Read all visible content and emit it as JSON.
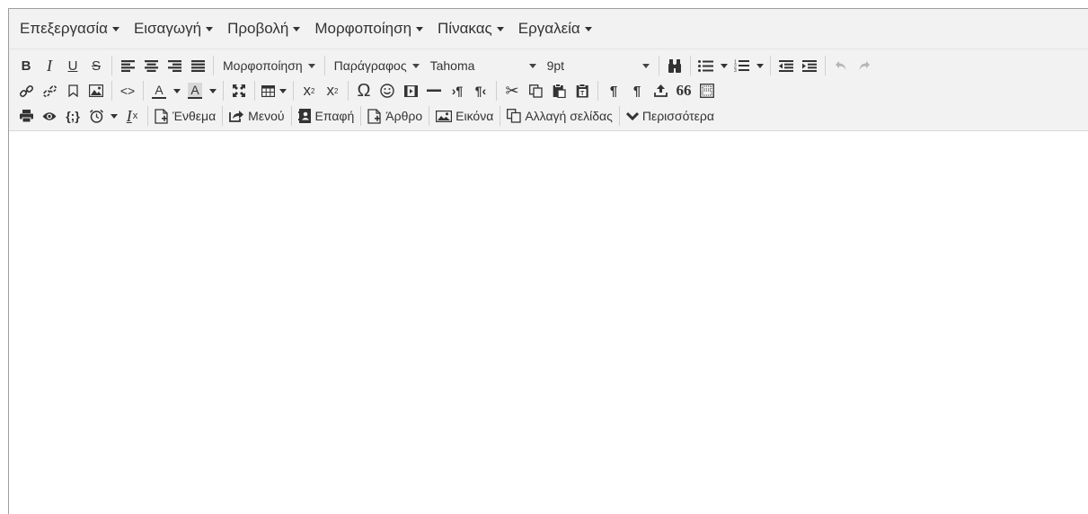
{
  "menubar": {
    "items": [
      {
        "label": "Επεξεργασία"
      },
      {
        "label": "Εισαγωγή"
      },
      {
        "label": "Προβολή"
      },
      {
        "label": "Μορφοποίηση"
      },
      {
        "label": "Πίνακας"
      },
      {
        "label": "Εργαλεία"
      }
    ]
  },
  "toolbar": {
    "bold": "B",
    "italic": "I",
    "underline": "U",
    "strikethrough": "S",
    "formats": "Μορφοποίηση",
    "paragraph": "Παράγραφος",
    "font_family": "Tahoma",
    "font_size": "9pt",
    "omega": "Ω",
    "subscript": "x",
    "superscript": "x",
    "code": "<>",
    "text_color_letter": "A",
    "bg_color_letter": "A",
    "insert_snippet": "Ένθεμα",
    "menu": "Μενού",
    "contact": "Επαφή",
    "article": "Άρθρο",
    "image": "Εικόνα",
    "page_break": "Αλλαγή σελίδας",
    "more": "Περισσότερα",
    "quote": "66",
    "braces": "{;}",
    "clear_format": "I",
    "pilcrow": "¶"
  },
  "colors": {
    "toolbar_bg": "#f2f2f2",
    "text": "#333333",
    "disabled": "#b5b5b5"
  }
}
